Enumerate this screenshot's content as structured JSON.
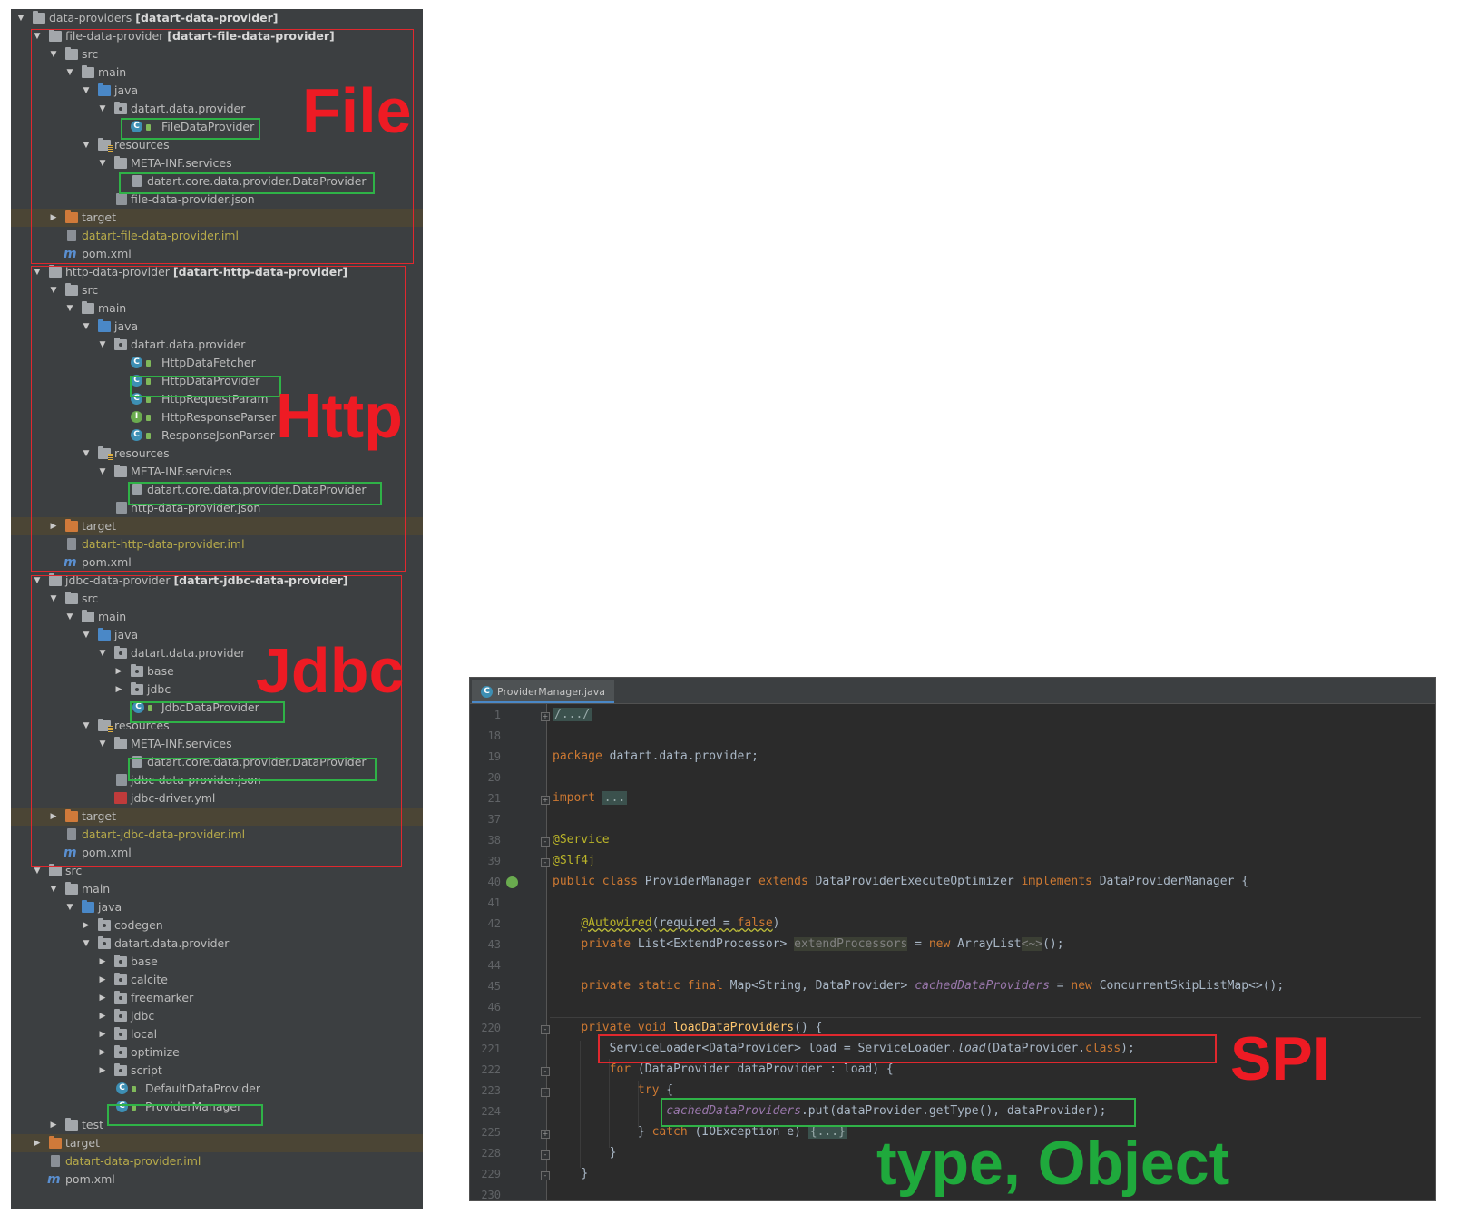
{
  "tree": {
    "root": {
      "name": "data-providers",
      "module": "[datart-data-provider]"
    },
    "file_module": {
      "header": {
        "name": "file-data-provider",
        "module": "[datart-file-data-provider]"
      },
      "src": "src",
      "main": "main",
      "java": "java",
      "package": "datart.data.provider",
      "classes": [
        "FileDataProvider"
      ],
      "resources": "resources",
      "meta_inf": "META-INF.services",
      "service_file": "datart.core.data.provider.DataProvider",
      "json": "file-data-provider.json",
      "target": "target",
      "iml": "datart-file-data-provider.iml",
      "pom": "pom.xml"
    },
    "http_module": {
      "header": {
        "name": "http-data-provider",
        "module": "[datart-http-data-provider]"
      },
      "src": "src",
      "main": "main",
      "java": "java",
      "package": "datart.data.provider",
      "classes": [
        "HttpDataFetcher",
        "HttpDataProvider",
        "HttpRequestParam",
        "HttpResponseParser",
        "ResponseJsonParser"
      ],
      "resources": "resources",
      "meta_inf": "META-INF.services",
      "service_file": "datart.core.data.provider.DataProvider",
      "json": "http-data-provider.json",
      "target": "target",
      "iml": "datart-http-data-provider.iml",
      "pom": "pom.xml"
    },
    "jdbc_module": {
      "header": {
        "name": "jdbc-data-provider",
        "module": "[datart-jdbc-data-provider]"
      },
      "src": "src",
      "main": "main",
      "java": "java",
      "package": "datart.data.provider",
      "subpackages": [
        "base",
        "jdbc"
      ],
      "classes": [
        "JdbcDataProvider"
      ],
      "resources": "resources",
      "meta_inf": "META-INF.services",
      "service_file": "datart.core.data.provider.DataProvider",
      "json": "jdbc-data-provider.json",
      "yml": "jdbc-driver.yml",
      "target": "target",
      "iml": "datart-jdbc-data-provider.iml",
      "pom": "pom.xml"
    },
    "root_src": {
      "src": "src",
      "main": "main",
      "java": "java",
      "codegen": "codegen",
      "package": "datart.data.provider",
      "subpackages": [
        "base",
        "calcite",
        "freemarker",
        "jdbc",
        "local",
        "optimize",
        "script"
      ],
      "classes": [
        "DefaultDataProvider",
        "ProviderManager"
      ],
      "test": "test",
      "target": "target",
      "iml": "datart-data-provider.iml",
      "pom": "pom.xml"
    }
  },
  "annotations": {
    "file": "File",
    "http": "Http",
    "jdbc": "Jdbc",
    "spi": "SPI",
    "type_object": "type, Object"
  },
  "editor": {
    "tab": "ProviderManager.java",
    "line_numbers": [
      "1",
      "18",
      "19",
      "20",
      "21",
      "37",
      "38",
      "39",
      "40",
      "41",
      "42",
      "43",
      "44",
      "45",
      "46",
      "220",
      "221",
      "222",
      "223",
      "224",
      "225",
      "228",
      "229",
      "230"
    ],
    "code": {
      "l1": "/.../",
      "l19_kw": "package",
      "l19_rest": " datart.data.provider;",
      "l21_kw": "import",
      "l21_rest": "...",
      "l38": "@Service",
      "l39": "@Slf4j",
      "l40_a": "public class",
      "l40_b": " ProviderManager ",
      "l40_c": "extends",
      "l40_d": " DataProviderExecuteOptimizer ",
      "l40_e": "implements",
      "l40_f": " DataProviderManager {",
      "l42_ann": "@Autowired",
      "l42_a": "(",
      "l42_b": "required",
      "l42_c": " = ",
      "l42_d": "false",
      "l42_e": ")",
      "l43_kw": "private",
      "l43_a": " List<ExtendProcessor> ",
      "l43_f": "extendProcessors",
      "l43_b": " = ",
      "l43_kw2": "new",
      "l43_c": " ArrayList",
      "l43_d": "<~>",
      "l43_e": "();",
      "l45_kw": "private static final",
      "l45_a": " Map<String, DataProvider> ",
      "l45_f": "cachedDataProviders",
      "l45_b": " = ",
      "l45_kw2": "new",
      "l45_c": " ConcurrentSkipListMap<>();",
      "l220_kw": "private void",
      "l220_fn": " loadDataProviders",
      "l220_rest": "() {",
      "l221_a": "ServiceLoader<DataProvider> load = ServiceLoader.",
      "l221_m": "load",
      "l221_b": "(DataProvider.",
      "l221_kw": "class",
      "l221_c": ");",
      "l222_kw": "for",
      "l222_rest": " (DataProvider dataProvider : load) {",
      "l223_kw": "try",
      "l223_rest": " {",
      "l224_f": "cachedDataProviders",
      "l224_rest": ".put(dataProvider.getType(), dataProvider);",
      "l225_a": "} ",
      "l225_kw": "catch",
      "l225_b": " (IOException e) ",
      "l225_c": "{...}",
      "l228": "}",
      "l229": "}"
    }
  },
  "colors": {
    "accent_red": "#ee1b24",
    "accent_green": "#1fa93c",
    "ide_bg": "#2b2b2b",
    "tree_bg": "#3c3f41"
  }
}
